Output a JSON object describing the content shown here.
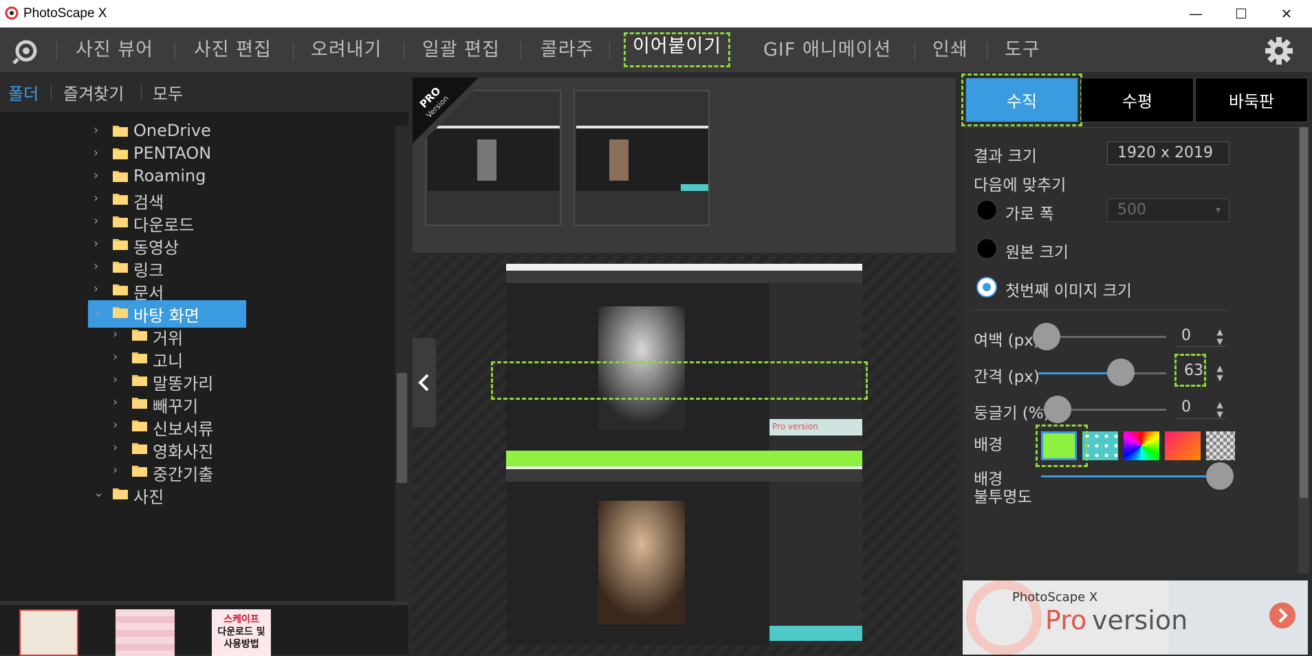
{
  "window": {
    "title": "PhotoScape X",
    "minimize": "—",
    "maximize": "☐",
    "close": "✕"
  },
  "menu": {
    "items": [
      "사진 뷰어",
      "사진 편집",
      "오려내기",
      "일괄 편집",
      "콜라주",
      "이어붙이기",
      "GIF 애니메이션",
      "인쇄",
      "도구"
    ],
    "active": "이어붙이기"
  },
  "left_tabs": [
    "폴더",
    "즐겨찾기",
    "모두"
  ],
  "tree": [
    {
      "label": "OneDrive",
      "level": 1,
      "expanded": false
    },
    {
      "label": "PENTAON",
      "level": 1,
      "expanded": false
    },
    {
      "label": "Roaming",
      "level": 1,
      "expanded": false
    },
    {
      "label": "검색",
      "level": 1,
      "expanded": false
    },
    {
      "label": "다운로드",
      "level": 1,
      "expanded": false
    },
    {
      "label": "동영상",
      "level": 1,
      "expanded": false
    },
    {
      "label": "링크",
      "level": 1,
      "expanded": false
    },
    {
      "label": "문서",
      "level": 1,
      "expanded": false
    },
    {
      "label": "바탕 화면",
      "level": 1,
      "expanded": true,
      "selected": true
    },
    {
      "label": "거위",
      "level": 2,
      "expanded": false
    },
    {
      "label": "고니",
      "level": 2,
      "expanded": false
    },
    {
      "label": "말똥가리",
      "level": 2,
      "expanded": false
    },
    {
      "label": "빼꾸기",
      "level": 2,
      "expanded": false
    },
    {
      "label": "신보서류",
      "level": 2,
      "expanded": false
    },
    {
      "label": "영화사진",
      "level": 2,
      "expanded": false
    },
    {
      "label": "중간기출",
      "level": 2,
      "expanded": false
    },
    {
      "label": "사진",
      "level": 1,
      "expanded": true
    }
  ],
  "bottom_thumb_text": [
    "스케이프",
    "다운로드 및",
    "사용방법"
  ],
  "pro_badge": [
    "PRO",
    "Version"
  ],
  "preview_ad_text": "Pro version",
  "right": {
    "tabs": [
      "수직",
      "수평",
      "바둑판"
    ],
    "active_tab": "수직",
    "result_size_label": "결과 크기",
    "result_size_value": "1920 x 2019",
    "fit_label": "다음에 맞추기",
    "fit_options": [
      "가로 폭",
      "원본 크기",
      "첫번째 이미지 크기"
    ],
    "fit_selected": "첫번째 이미지 크기",
    "width_value": "500",
    "margin_label": "여백 (px)",
    "margin_value": "0",
    "margin_fraction": 0.0,
    "spacing_label": "간격 (px)",
    "spacing_value": "63",
    "spacing_fraction": 0.5,
    "roundness_label": "둥글기 (%)",
    "roundness_value": "0",
    "roundness_fraction": 0.0,
    "background_label": "배경",
    "opacity_label_1": "배경",
    "opacity_label_2": "불투명도",
    "opacity_fraction": 1.0,
    "swatches": [
      "#8ef040",
      "#4fc8c8",
      "rainbow",
      "#ff3060",
      "checker"
    ]
  },
  "ad": {
    "brand": "PhotoScape X",
    "pro": "Pro",
    "version": " version"
  },
  "colors": {
    "accent": "#3b9be0",
    "highlight_dash": "#8ed73a",
    "gap_color": "#8ef040"
  }
}
